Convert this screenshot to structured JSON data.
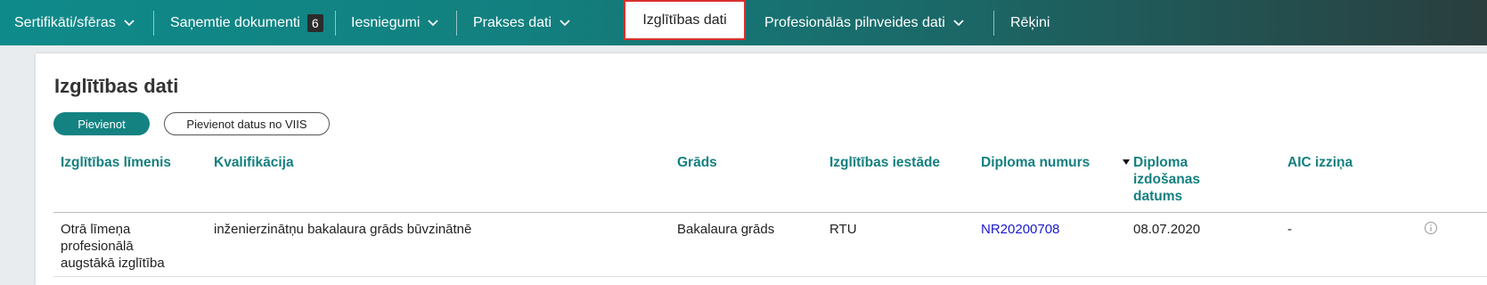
{
  "nav": {
    "items": [
      {
        "label": "Sertifikāti/sfēras",
        "dropdown": true
      },
      {
        "label": "Saņemtie dokumenti",
        "badge": "6"
      },
      {
        "label": "Iesniegumi",
        "dropdown": true
      },
      {
        "label": "Prakses dati",
        "dropdown": true
      },
      {
        "label": "Izglītības dati",
        "active": true
      },
      {
        "label": "Profesionālās pilnveides dati",
        "dropdown": true
      },
      {
        "label": "Rēķini"
      }
    ]
  },
  "page": {
    "title": "Izglītības dati",
    "add_button": "Pievienot",
    "import_button": "Pievienot datus no VIIS"
  },
  "table": {
    "columns": [
      "Izglītības līmenis",
      "Kvalifikācija",
      "Grāds",
      "Izglītības iestāde",
      "Diploma numurs",
      "Diploma izdošanas datums",
      "AIC izziņa"
    ],
    "sorted_column": "Diploma izdošanas datums",
    "rows": [
      {
        "level": "Otrā līmeņa profesionālā augstākā izglītība",
        "qualification": "inženierzinātņu bakalaura grāds būvzinātnē",
        "degree": "Bakalaura grāds",
        "institution": "RTU",
        "diploma_number": "NR20200708",
        "issue_date": "08.07.2020",
        "aic": "-"
      }
    ]
  },
  "colors": {
    "accent": "#138281",
    "active_border": "#d9312e",
    "link": "#1a1acc"
  },
  "icons": [
    "chevron-down-icon",
    "info-icon",
    "sort-desc-icon"
  ]
}
